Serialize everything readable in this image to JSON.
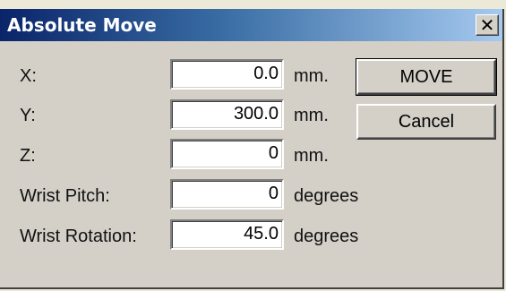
{
  "window": {
    "title": "Absolute Move",
    "close_glyph": "✕"
  },
  "fields": [
    {
      "label": "X:",
      "value": "0.0",
      "unit": "mm."
    },
    {
      "label": "Y:",
      "value": "300.0",
      "unit": "mm."
    },
    {
      "label": "Z:",
      "value": "0",
      "unit": "mm."
    },
    {
      "label": "Wrist Pitch:",
      "value": "0",
      "unit": "degrees"
    },
    {
      "label": "Wrist Rotation:",
      "value": "45.0",
      "unit": "degrees"
    }
  ],
  "buttons": {
    "move_label": "MOVE",
    "cancel_label": "Cancel"
  },
  "colors": {
    "titlebar_start": "#0a246a",
    "titlebar_end": "#a6caf0",
    "dialog_face": "#d4d0c8"
  },
  "icons": {
    "close": "close-icon"
  }
}
